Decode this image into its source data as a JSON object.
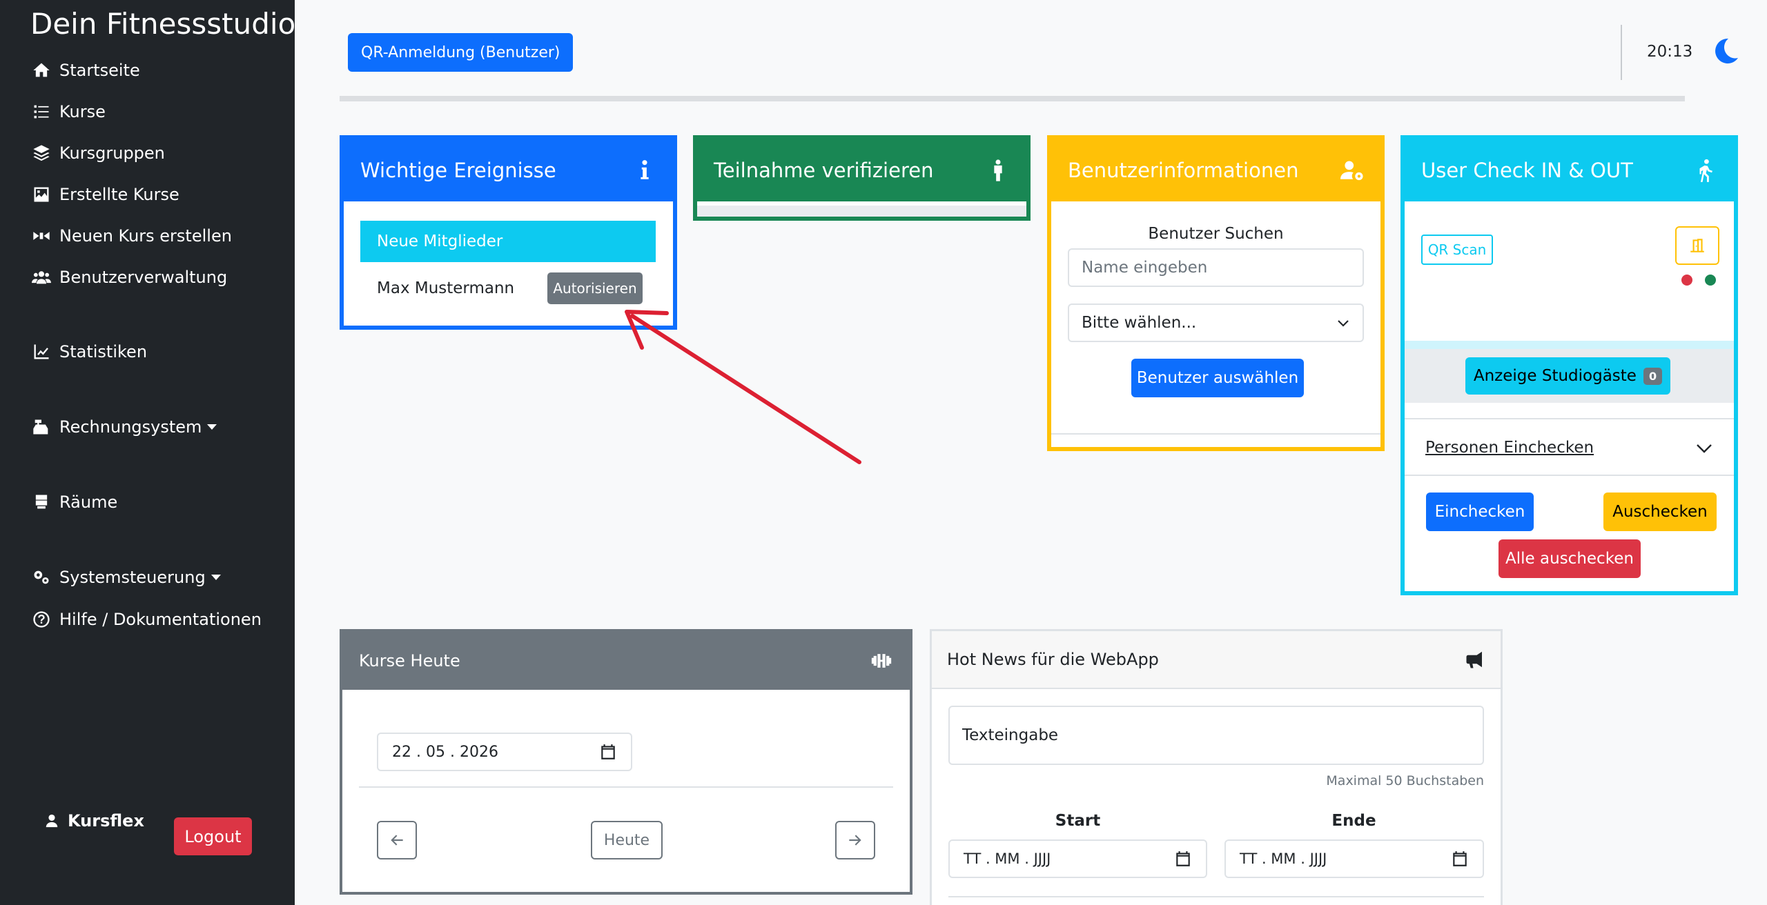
{
  "sidebar": {
    "brand": "Dein Fitnessstudio",
    "items": [
      {
        "label": "Startseite",
        "icon": "home-icon"
      },
      {
        "label": "Kurse",
        "icon": "list-icon"
      },
      {
        "label": "Kursgruppen",
        "icon": "layers-icon"
      },
      {
        "label": "Erstellte Kurse",
        "icon": "image-icon"
      },
      {
        "label": "Neuen Kurs erstellen",
        "icon": "film-icon"
      },
      {
        "label": "Benutzerverwaltung",
        "icon": "users-icon"
      },
      {
        "label": "Statistiken",
        "icon": "chart-line-icon"
      },
      {
        "label": "Rechnungsystem",
        "icon": "cash-register-icon"
      },
      {
        "label": "Räume",
        "icon": "server-icon"
      },
      {
        "label": "Systemsteuerung",
        "icon": "gears-icon"
      },
      {
        "label": "Hilfe / Dokumentationen",
        "icon": "question-circle-icon"
      }
    ],
    "user": "Kursflex",
    "logout": "Logout"
  },
  "topbar": {
    "qr_login": "QR-Anmeldung (Benutzer)",
    "time": "20:13"
  },
  "events_card": {
    "title": "Wichtige Ereignisse",
    "active_item": "Neue Mitglieder",
    "member": "Max Mustermann",
    "authorize": "Autorisieren"
  },
  "verify_card": {
    "title": "Teilnahme verifizieren"
  },
  "userinfo_card": {
    "title": "Benutzerinformationen",
    "search_label": "Benutzer Suchen",
    "name_placeholder": "Name eingeben",
    "select_value": "Bitte wählen...",
    "select_button": "Benutzer auswählen"
  },
  "checkin_card": {
    "title": "User Check IN & OUT",
    "qr_scan": "QR Scan",
    "guests_label": "Anzeige Studiogäste",
    "guests_count": "0",
    "accordion": "Personen Einchecken",
    "checkin": "Einchecken",
    "checkout": "Auschecken",
    "checkout_all": "Alle auschecken"
  },
  "courses_card": {
    "title": "Kurse Heute",
    "date": "22 . 05 . 2026",
    "today": "Heute"
  },
  "news_card": {
    "title": "Hot News für die WebApp",
    "text_value": "Texteingabe",
    "hint": "Maximal 50 Buchstaben",
    "start_label": "Start",
    "end_label": "Ende",
    "start_placeholder": "TT . MM . JJJJ",
    "end_placeholder": "TT . MM . JJJJ"
  },
  "colors": {
    "primary": "#0d6efd",
    "success": "#198754",
    "warning": "#ffc107",
    "info": "#0dcaf0",
    "danger": "#dc3545",
    "secondary": "#6c757d",
    "sidebar": "#212529",
    "annotation_arrow": "#dc2032"
  }
}
